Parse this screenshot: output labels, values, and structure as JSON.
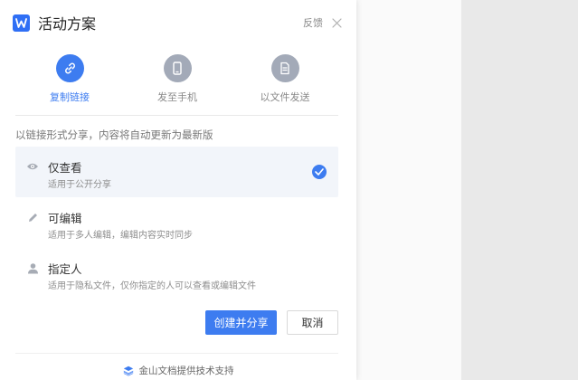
{
  "header": {
    "logo_letter": "W",
    "title": "活动方案",
    "feedback_label": "反馈"
  },
  "methods": [
    {
      "label": "复制链接",
      "icon": "link-icon",
      "active": true
    },
    {
      "label": "发至手机",
      "icon": "phone-icon",
      "active": false
    },
    {
      "label": "以文件发送",
      "icon": "file-icon",
      "active": false
    }
  ],
  "description": "以链接形式分享，内容将自动更新为最新版",
  "options": [
    {
      "title": "仅查看",
      "subtitle": "适用于公开分享",
      "icon": "eye-icon",
      "selected": true
    },
    {
      "title": "可编辑",
      "subtitle": "适用于多人编辑，编辑内容实时同步",
      "icon": "pencil-icon",
      "selected": false
    },
    {
      "title": "指定人",
      "subtitle": "适用于隐私文件，仅你指定的人可以查看或编辑文件",
      "icon": "person-icon",
      "selected": false
    }
  ],
  "buttons": {
    "create_share": "创建并分享",
    "cancel": "取消"
  },
  "footer": {
    "text": "金山文档提供技术支持",
    "icon": "kingsoft-docs-logo-icon"
  },
  "colors": {
    "accent": "#3d7cf0",
    "logo": "#2f6ff5",
    "inactive_circle": "#a3aab8",
    "selected_bg": "#f2f5fa"
  }
}
